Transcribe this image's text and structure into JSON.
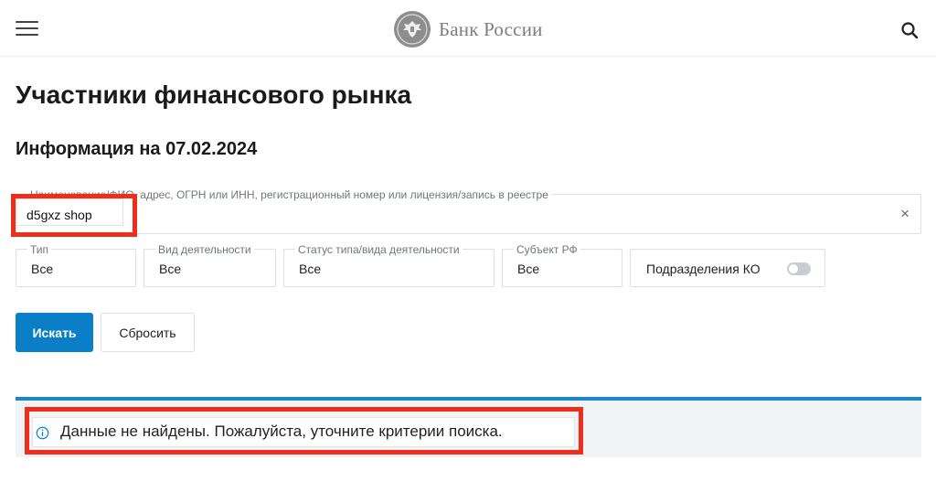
{
  "header": {
    "logo_text": "Банк России",
    "menu_icon": "hamburger-menu-icon",
    "search_icon": "search-icon",
    "emblem_icon": "double-headed-eagle-emblem"
  },
  "page": {
    "title": "Участники финансового рынка",
    "info_date": "Информация на 07.02.2024"
  },
  "search": {
    "label": "Наименование/ФИО, адрес, ОГРН или ИНН, регистрационный номер или лицензия/запись в реестре",
    "value": "d5gxz shop",
    "clear_glyph": "×"
  },
  "filters": [
    {
      "label": "Тип",
      "value": "Все"
    },
    {
      "label": "Вид деятельности",
      "value": "Все"
    },
    {
      "label": "Статус типа/вида деятельности",
      "value": "Все"
    },
    {
      "label": "Субъект РФ",
      "value": "Все"
    }
  ],
  "toggle": {
    "label": "Подразделения КО",
    "state": "off"
  },
  "buttons": {
    "search_label": "Искать",
    "reset_label": "Сбросить"
  },
  "notice": {
    "text": "Данные не найдены. Пожалуйста, уточните критерии поиска.",
    "icon": "info-icon"
  },
  "colors": {
    "accent": "#0a7fc8",
    "divider": "#1a86c9",
    "highlight": "#ee2e1b",
    "notice_bg": "#f2f3f5"
  }
}
